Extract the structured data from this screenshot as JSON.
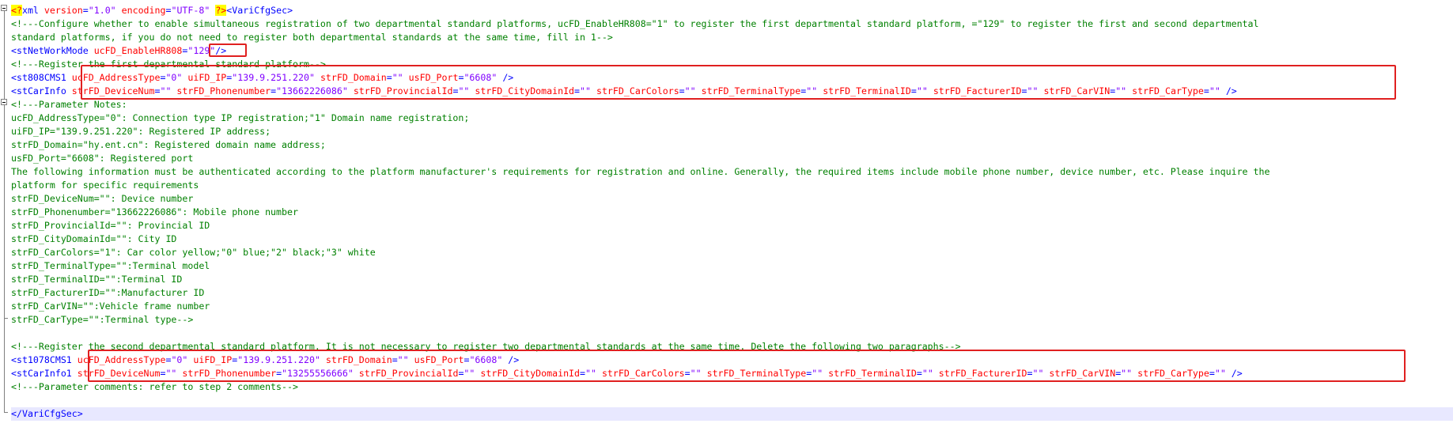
{
  "editor": {
    "lines": [
      {
        "kind": "pi",
        "text_start": "<?",
        "text_mid": "xml ",
        "attr1": "version",
        "eq1": "=",
        "val1": "\"1.0\"",
        "sp1": " ",
        "attr2": "encoding",
        "eq2": "=",
        "val2": "\"UTF-8\"",
        "sp2": " ",
        "end": "?>",
        "tag": "<VariCfgSec>"
      },
      {
        "kind": "comment",
        "text": "<!---Configure whether to enable simultaneous registration of two departmental standard platforms, ucFD_EnableHR808=\"1\" to register the first departmental standard platform, =\"129\" to register the first and second departmental"
      },
      {
        "kind": "comment",
        "text": "standard platforms, if you do not need to register both departmental standards at the same time, fill in 1-->"
      },
      {
        "kind": "netmode",
        "tag_open": "<stNetWorkMode ",
        "attr": "ucFD_EnableHR808",
        "eq": "=",
        "val": "\"129\"",
        "tag_close": "/>"
      },
      {
        "kind": "comment",
        "text": "<!---Register the first departmental standard platform-->"
      },
      {
        "kind": "element",
        "tag_open": "<st808CMS1 ",
        "attrs": [
          {
            "name": "ucFD_AddressType",
            "value": "\"0\""
          },
          {
            "name": "uiFD_IP",
            "value": "\"139.9.251.220\""
          },
          {
            "name": "strFD_Domain",
            "value": "\"\""
          },
          {
            "name": "usFD_Port",
            "value": "\"6608\""
          }
        ],
        "tag_close": " />"
      },
      {
        "kind": "element",
        "tag_open": "<stCarInfo ",
        "attrs": [
          {
            "name": "strFD_DeviceNum",
            "value": "\"\""
          },
          {
            "name": "strFD_Phonenumber",
            "value": "\"13662226086\""
          },
          {
            "name": "strFD_ProvincialId",
            "value": "\"\""
          },
          {
            "name": "strFD_CityDomainId",
            "value": "\"\""
          },
          {
            "name": "strFD_CarColors",
            "value": "\"\""
          },
          {
            "name": "strFD_TerminalType",
            "value": "\"\""
          },
          {
            "name": "strFD_TerminalID",
            "value": "\"\""
          },
          {
            "name": "strFD_FacturerID",
            "value": "\"\""
          },
          {
            "name": "strFD_CarVIN",
            "value": "\"\""
          },
          {
            "name": "strFD_CarType",
            "value": "\"\""
          }
        ],
        "tag_close": " />"
      },
      {
        "kind": "comment",
        "text": "<!---Parameter Notes:"
      },
      {
        "kind": "comment",
        "text": "ucFD_AddressType=\"0\": Connection type IP registration;\"1\" Domain name registration;"
      },
      {
        "kind": "comment",
        "text": "uiFD_IP=\"139.9.251.220\": Registered IP address;"
      },
      {
        "kind": "comment",
        "text": "strFD_Domain=\"hy.ent.cn\": Registered domain name address;"
      },
      {
        "kind": "comment",
        "text": "usFD_Port=\"6608\": Registered port"
      },
      {
        "kind": "comment",
        "text": "The following information must be authenticated according to the platform manufacturer's requirements for registration and online. Generally, the required items include mobile phone number, device number, etc. Please inquire the"
      },
      {
        "kind": "comment",
        "text": "platform for specific requirements"
      },
      {
        "kind": "comment",
        "text": "strFD_DeviceNum=\"\": Device number"
      },
      {
        "kind": "comment",
        "text": "strFD_Phonenumber=\"13662226086\": Mobile phone number"
      },
      {
        "kind": "comment",
        "text": "strFD_ProvincialId=\"\": Provincial ID"
      },
      {
        "kind": "comment",
        "text": "strFD_CityDomainId=\"\": City ID"
      },
      {
        "kind": "comment",
        "text": "strFD_CarColors=\"1\": Car color yellow;\"0\" blue;\"2\" black;\"3\" white"
      },
      {
        "kind": "comment",
        "text": "strFD_TerminalType=\"\":Terminal model"
      },
      {
        "kind": "comment",
        "text": "strFD_TerminalID=\"\":Terminal ID"
      },
      {
        "kind": "comment",
        "text": "strFD_FacturerID=\"\":Manufacturer ID"
      },
      {
        "kind": "comment",
        "text": "strFD_CarVIN=\"\":Vehicle frame number"
      },
      {
        "kind": "comment",
        "text": "strFD_CarType=\"\":Terminal type-->"
      },
      {
        "kind": "blank",
        "text": ""
      },
      {
        "kind": "comment",
        "text": "<!---Register the second departmental standard platform. It is not necessary to register two departmental standards at the same time. Delete the following two paragraphs-->"
      },
      {
        "kind": "element",
        "tag_open": "<st1078CMS1 ",
        "attrs": [
          {
            "name": "ucFD_AddressType",
            "value": "\"0\""
          },
          {
            "name": "uiFD_IP",
            "value": "\"139.9.251.220\""
          },
          {
            "name": "strFD_Domain",
            "value": "\"\""
          },
          {
            "name": "usFD_Port",
            "value": "\"6608\""
          }
        ],
        "tag_close": " />"
      },
      {
        "kind": "element",
        "tag_open": "<stCarInfo1 ",
        "attrs": [
          {
            "name": "strFD_DeviceNum",
            "value": "\"\""
          },
          {
            "name": "strFD_Phonenumber",
            "value": "\"13255556666\""
          },
          {
            "name": "strFD_ProvincialId",
            "value": "\"\""
          },
          {
            "name": "strFD_CityDomainId",
            "value": "\"\""
          },
          {
            "name": "strFD_CarColors",
            "value": "\"\""
          },
          {
            "name": "strFD_TerminalType",
            "value": "\"\""
          },
          {
            "name": "strFD_TerminalID",
            "value": "\"\""
          },
          {
            "name": "strFD_FacturerID",
            "value": "\"\""
          },
          {
            "name": "strFD_CarVIN",
            "value": "\"\""
          },
          {
            "name": "strFD_CarType",
            "value": "\"\""
          }
        ],
        "tag_close": " />"
      },
      {
        "kind": "comment",
        "text": "<!---Parameter comments: refer to step 2 comments-->"
      },
      {
        "kind": "blank",
        "text": ""
      },
      {
        "kind": "closetag",
        "text": "</VariCfgSec>"
      }
    ]
  },
  "colors": {
    "comment": "#008000",
    "tag": "#0000ff",
    "attribute": "#ff0000",
    "value": "#8000ff",
    "highlight_box": "#e02020",
    "pi_background": "#ffff00",
    "current_line": "#e8e8ff"
  }
}
